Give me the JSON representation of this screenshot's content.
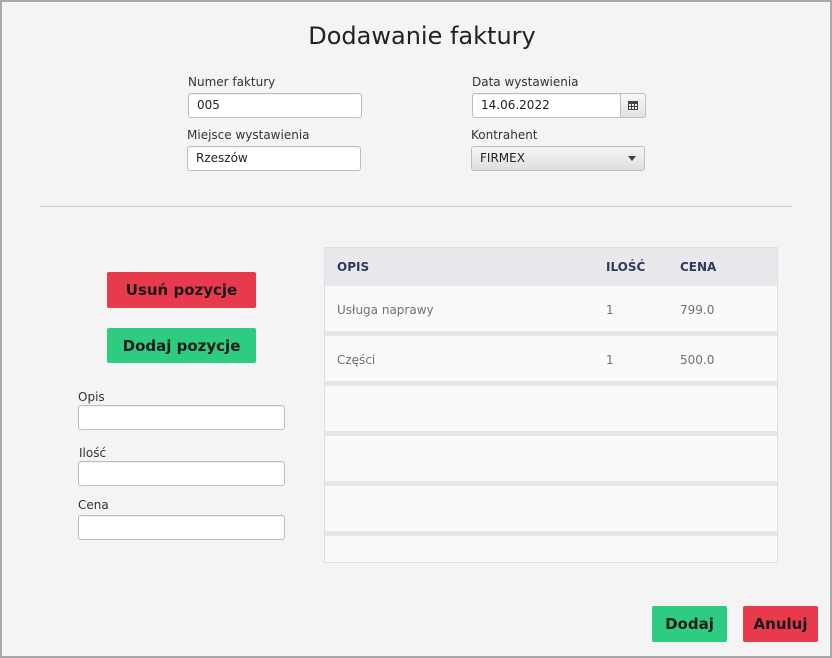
{
  "title": "Dodawanie faktury",
  "form": {
    "numer_label": "Numer faktury",
    "numer_value": "005",
    "miejsce_label": "Miejsce wystawienia",
    "miejsce_value": "Rzeszów",
    "data_label": "Data wystawienia",
    "data_value": "14.06.2022",
    "kontrahent_label": "Kontrahent",
    "kontrahent_value": "FIRMEX"
  },
  "left": {
    "usun_label": "Usuń pozycje",
    "dodaj_label": "Dodaj pozycje",
    "opis_label": "Opis",
    "ilosc_label": "Ilość",
    "cena_label": "Cena"
  },
  "table": {
    "headers": [
      "OPIS",
      "ILOŚĆ",
      "CENA"
    ],
    "rows": [
      [
        "Usługa naprawy",
        "1",
        "799.0"
      ],
      [
        "Części",
        "1",
        "500.0"
      ],
      [
        "",
        "",
        ""
      ],
      [
        "",
        "",
        ""
      ],
      [
        "",
        "",
        ""
      ],
      [
        "",
        "",
        ""
      ]
    ]
  },
  "footer": {
    "dodaj_label": "Dodaj",
    "anuluj_label": "Anuluj"
  },
  "colors": {
    "red": "#e73a4d",
    "green": "#2ecc80"
  }
}
